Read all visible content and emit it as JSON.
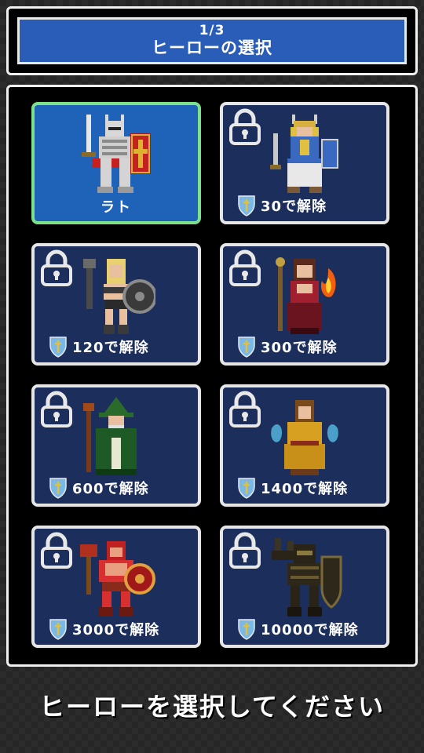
{
  "header": {
    "page_indicator": "1/3",
    "title": "ヒーローの選択"
  },
  "heroes": [
    {
      "name": "ラト",
      "locked": false,
      "selected": true,
      "portrait": "knight-portrait"
    },
    {
      "cost": "30",
      "unlock_suffix": "で解除",
      "locked": true,
      "portrait": "valkyrie-portrait"
    },
    {
      "cost": "120",
      "unlock_suffix": "で解除",
      "locked": true,
      "portrait": "amazon-warrior-portrait"
    },
    {
      "cost": "300",
      "unlock_suffix": "で解除",
      "locked": true,
      "portrait": "fire-sorceress-portrait"
    },
    {
      "cost": "600",
      "unlock_suffix": "で解除",
      "locked": true,
      "portrait": "green-wizard-portrait"
    },
    {
      "cost": "1400",
      "unlock_suffix": "で解除",
      "locked": true,
      "portrait": "monk-portrait"
    },
    {
      "cost": "3000",
      "unlock_suffix": "で解除",
      "locked": true,
      "portrait": "barbarian-portrait"
    },
    {
      "cost": "10000",
      "unlock_suffix": "で解除",
      "locked": true,
      "portrait": "dark-knight-portrait"
    }
  ],
  "prompt": "ヒーローを選択してください",
  "colors": {
    "header_blue": "#2a5db8",
    "card_blue": "#1c2f5c",
    "selected_card_blue": "#1e63b8",
    "selected_border": "#7de08a",
    "frame_white": "#f0f0f0"
  }
}
